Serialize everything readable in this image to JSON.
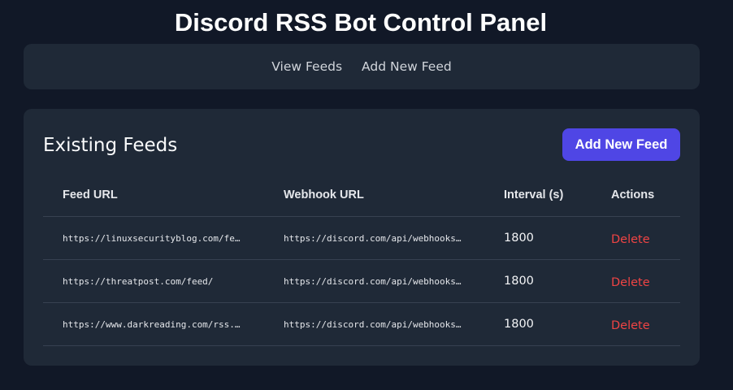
{
  "page_title": "Discord RSS Bot Control Panel",
  "nav": {
    "view_feeds": "View Feeds",
    "add_new_feed": "Add New Feed"
  },
  "panel": {
    "title": "Existing Feeds",
    "add_button": "Add New Feed"
  },
  "table": {
    "headers": [
      "Feed URL",
      "Webhook URL",
      "Interval (s)",
      "Actions"
    ],
    "rows": [
      {
        "feed_url": "https://linuxsecurityblog.com/fe…",
        "webhook_url": "https://discord.com/api/webhooks…",
        "interval": "1800",
        "action": "Delete"
      },
      {
        "feed_url": "https://threatpost.com/feed/",
        "webhook_url": "https://discord.com/api/webhooks…",
        "interval": "1800",
        "action": "Delete"
      },
      {
        "feed_url": "https://www.darkreading.com/rss.…",
        "webhook_url": "https://discord.com/api/webhooks…",
        "interval": "1800",
        "action": "Delete"
      }
    ]
  },
  "colors": {
    "background": "#111827",
    "panel": "#1f2937",
    "accent": "#4f46e5",
    "danger": "#ef4444"
  }
}
